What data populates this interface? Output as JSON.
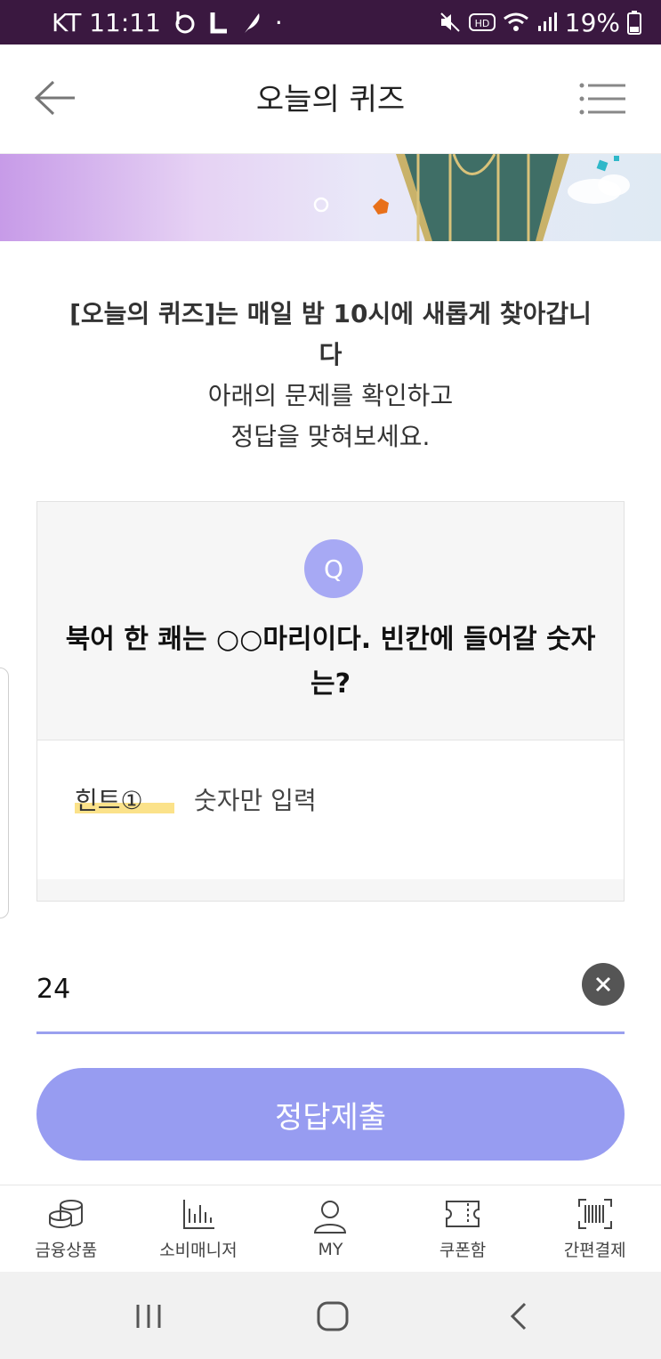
{
  "status_bar": {
    "carrier_time": "KT 11:11",
    "battery": "19%",
    "dot": "·"
  },
  "header": {
    "title": "오늘의 퀴즈"
  },
  "intro": {
    "line1": "[오늘의 퀴즈]는 매일 밤 10시에 새롭게 찾아갑니",
    "line2": "다",
    "line3": "아래의 문제를 확인하고",
    "line4": "정답을 맞혀보세요."
  },
  "quiz": {
    "badge": "Q",
    "question": "북어 한 쾌는 ○○마리이다. 빈칸에 들어갈 숫자는?",
    "hint_label": "힌트①",
    "hint_text": "숫자만 입력"
  },
  "answer": {
    "value": "24"
  },
  "submit": {
    "label": "정답제출"
  },
  "tabbar": {
    "items": [
      {
        "label": "금융상품",
        "icon": "coins-icon"
      },
      {
        "label": "소비매니저",
        "icon": "bar-chart-icon"
      },
      {
        "label": "MY",
        "icon": "person-icon"
      },
      {
        "label": "쿠폰함",
        "icon": "ticket-icon"
      },
      {
        "label": "간편결제",
        "icon": "barcode-icon"
      }
    ]
  },
  "colors": {
    "status_bar": "#3a1840",
    "accent": "#979cf1",
    "badge": "#a7a9f4",
    "hint_highlight": "#fbe28a"
  }
}
